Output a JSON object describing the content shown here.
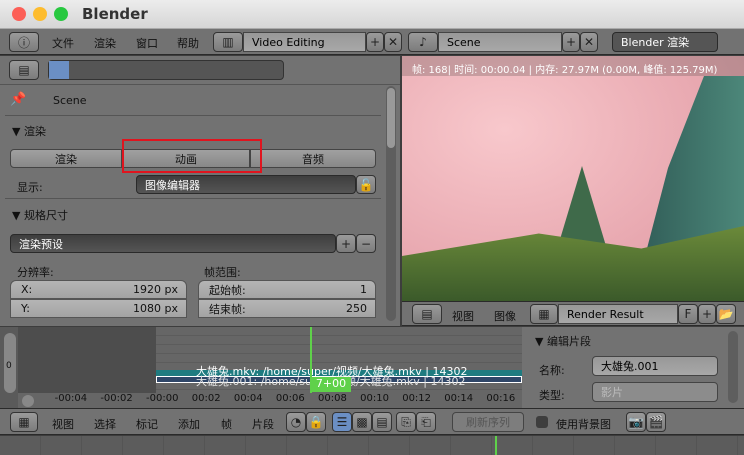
{
  "window": {
    "title": "Blender"
  },
  "topbar": {
    "menus": [
      "文件",
      "渲染",
      "窗口",
      "帮助"
    ],
    "layout": "Video Editing",
    "scene": "Scene",
    "engine": "Blender 渲染"
  },
  "properties": {
    "context": "Scene",
    "render": {
      "header": "渲染",
      "buttons": [
        "渲染",
        "动画",
        "音频"
      ],
      "display_label": "显示:",
      "display_value": "图像编辑器"
    },
    "dimensions": {
      "header": "规格尺寸",
      "preset": "渲染预设",
      "resolution_label": "分辨率:",
      "x_label": "X:",
      "x_value": "1920 px",
      "y_label": "Y:",
      "y_value": "1080 px",
      "frame_range_label": "帧范围:",
      "start_label": "起始帧:",
      "start_value": "1",
      "end_label": "结束帧:",
      "end_value": "250"
    }
  },
  "image_editor": {
    "info": "帧: 168| 时间: 00:00.04 | 内存: 27.97M (0.00M, 峰值: 125.79M)",
    "menus": [
      "视图",
      "图像"
    ],
    "image": "Render Result",
    "f_label": "F"
  },
  "sequencer": {
    "channel_label": "0",
    "strip1": "大雄兔.mkv: /home/super/视频/大雄兔.mkv | 14302",
    "strip2": "大雄兔.001: /home/super/视频/大雄兔.mkv | 14302",
    "current_frame": "7+00",
    "ticks": [
      "-00:04",
      "-00:02",
      "-00:00",
      "00:02",
      "00:04",
      "00:06",
      "00:08",
      "00:10",
      "00:12",
      "00:14",
      "00:16"
    ],
    "menus": [
      "视图",
      "选择",
      "标记",
      "添加",
      "帧",
      "片段"
    ],
    "refresh": "刷新序列",
    "use_backdrop": "使用背景图",
    "strip_panel": {
      "header": "编辑片段",
      "name_label": "名称:",
      "name_value": "大雄兔.001",
      "type_label": "类型:",
      "type_value": "影片"
    }
  },
  "colors": {
    "highlight": "#e0141e",
    "playhead": "#5fd14a",
    "strip_teal": "#1f7b80",
    "strip_blue": "#2f4668"
  }
}
